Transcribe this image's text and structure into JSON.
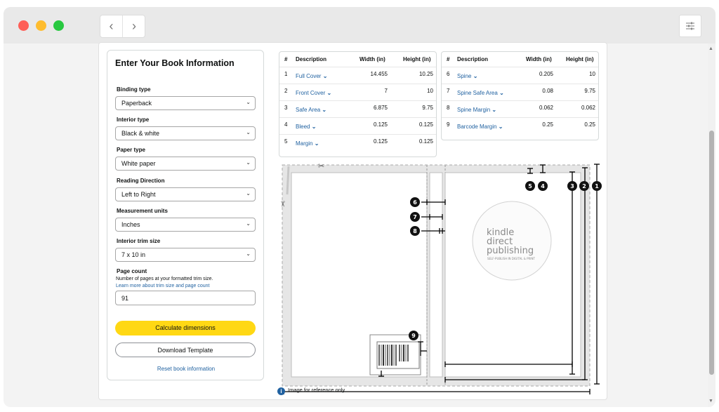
{
  "window": {
    "back_glyph": "‹",
    "forward_glyph": "›",
    "settings_icon": "sliders-icon"
  },
  "form": {
    "title": "Enter Your Book Information",
    "binding_label": "Binding type",
    "binding_value": "Paperback",
    "interior_label": "Interior type",
    "interior_value": "Black & white",
    "paper_label": "Paper type",
    "paper_value": "White paper",
    "reading_label": "Reading Direction",
    "reading_value": "Left to Right",
    "units_label": "Measurement units",
    "units_value": "Inches",
    "trim_label": "Interior trim size",
    "trim_value": "7 x 10 in",
    "page_count_label": "Page count",
    "page_count_hint": "Number of pages at your formatted trim size.",
    "page_count_link": "Learn more about trim size and page count",
    "page_count_value": "91",
    "calculate_label": "Calculate dimensions",
    "download_label": "Download Template",
    "reset_label": "Reset book information"
  },
  "table_left": {
    "headers": [
      "#",
      "Description",
      "Width (in)",
      "Height (in)"
    ],
    "rows": [
      {
        "n": "1",
        "desc": "Full Cover",
        "w": "14.455",
        "h": "10.25"
      },
      {
        "n": "2",
        "desc": "Front Cover",
        "w": "7",
        "h": "10"
      },
      {
        "n": "3",
        "desc": "Safe Area",
        "w": "6.875",
        "h": "9.75"
      },
      {
        "n": "4",
        "desc": "Bleed",
        "w": "0.125",
        "h": "0.125"
      },
      {
        "n": "5",
        "desc": "Margin",
        "w": "0.125",
        "h": "0.125"
      }
    ]
  },
  "table_right": {
    "headers": [
      "#",
      "Description",
      "Width (in)",
      "Height (in)"
    ],
    "rows": [
      {
        "n": "6",
        "desc": "Spine",
        "w": "0.205",
        "h": "10"
      },
      {
        "n": "7",
        "desc": "Spine Safe Area",
        "w": "0.08",
        "h": "9.75"
      },
      {
        "n": "8",
        "desc": "Spine Margin",
        "w": "0.062",
        "h": "0.062"
      },
      {
        "n": "9",
        "desc": "Barcode Margin",
        "w": "0.25",
        "h": "0.25"
      }
    ]
  },
  "diagram": {
    "logo_line1": "kindle",
    "logo_line2": "direct",
    "logo_line3": "publishing",
    "logo_tagline": "SELF-PUBLISH IN DIGITAL & PRINT",
    "markers": [
      "1",
      "2",
      "3",
      "4",
      "5",
      "6",
      "7",
      "8",
      "9"
    ],
    "reference_note": "Image for reference only"
  }
}
